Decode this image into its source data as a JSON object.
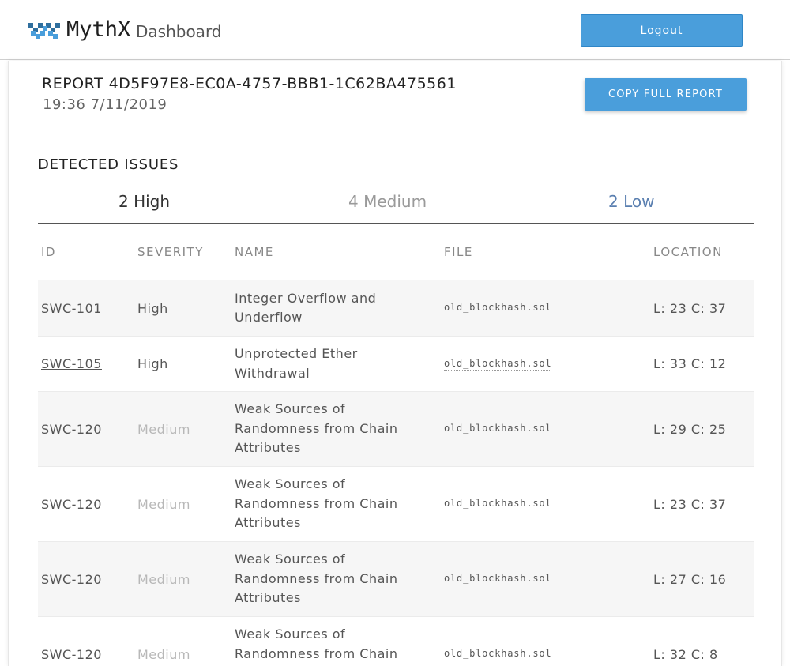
{
  "header": {
    "brand": "MythX",
    "subtitle": "Dashboard",
    "logout_label": "Logout"
  },
  "report": {
    "title": "REPORT 4D5F97E8-EC0A-4757-BBB1-1C62BA475561",
    "date": "19:36 7/11/2019",
    "copy_label": "COPY FULL REPORT"
  },
  "issues": {
    "section_title": "DETECTED ISSUES",
    "tabs": [
      {
        "label": "2 High"
      },
      {
        "label": "4 Medium"
      },
      {
        "label": "2 Low"
      }
    ],
    "columns": {
      "id": "ID",
      "severity": "SEVERITY",
      "name": "NAME",
      "file": "FILE",
      "location": "LOCATION"
    },
    "rows": [
      {
        "id": "SWC-101",
        "severity": "High",
        "name": "Integer Overflow and Underflow",
        "file": "old_blockhash.sol",
        "location": "L: 23 C: 37"
      },
      {
        "id": "SWC-105",
        "severity": "High",
        "name": "Unprotected Ether Withdrawal",
        "file": "old_blockhash.sol",
        "location": "L: 33 C: 12"
      },
      {
        "id": "SWC-120",
        "severity": "Medium",
        "name": "Weak Sources of Randomness from Chain Attributes",
        "file": "old_blockhash.sol",
        "location": "L: 29 C: 25"
      },
      {
        "id": "SWC-120",
        "severity": "Medium",
        "name": "Weak Sources of Randomness from Chain Attributes",
        "file": "old_blockhash.sol",
        "location": "L: 23 C: 37"
      },
      {
        "id": "SWC-120",
        "severity": "Medium",
        "name": "Weak Sources of Randomness from Chain Attributes",
        "file": "old_blockhash.sol",
        "location": "L: 27 C: 16"
      },
      {
        "id": "SWC-120",
        "severity": "Medium",
        "name": "Weak Sources of Randomness from Chain Attributes",
        "file": "old_blockhash.sol",
        "location": "L: 32 C: 8"
      }
    ]
  },
  "colors": {
    "accent": "#4a9edb",
    "severity_high": "#555555",
    "severity_medium": "#b8b8b8",
    "tab_low": "#5a7fb0"
  }
}
